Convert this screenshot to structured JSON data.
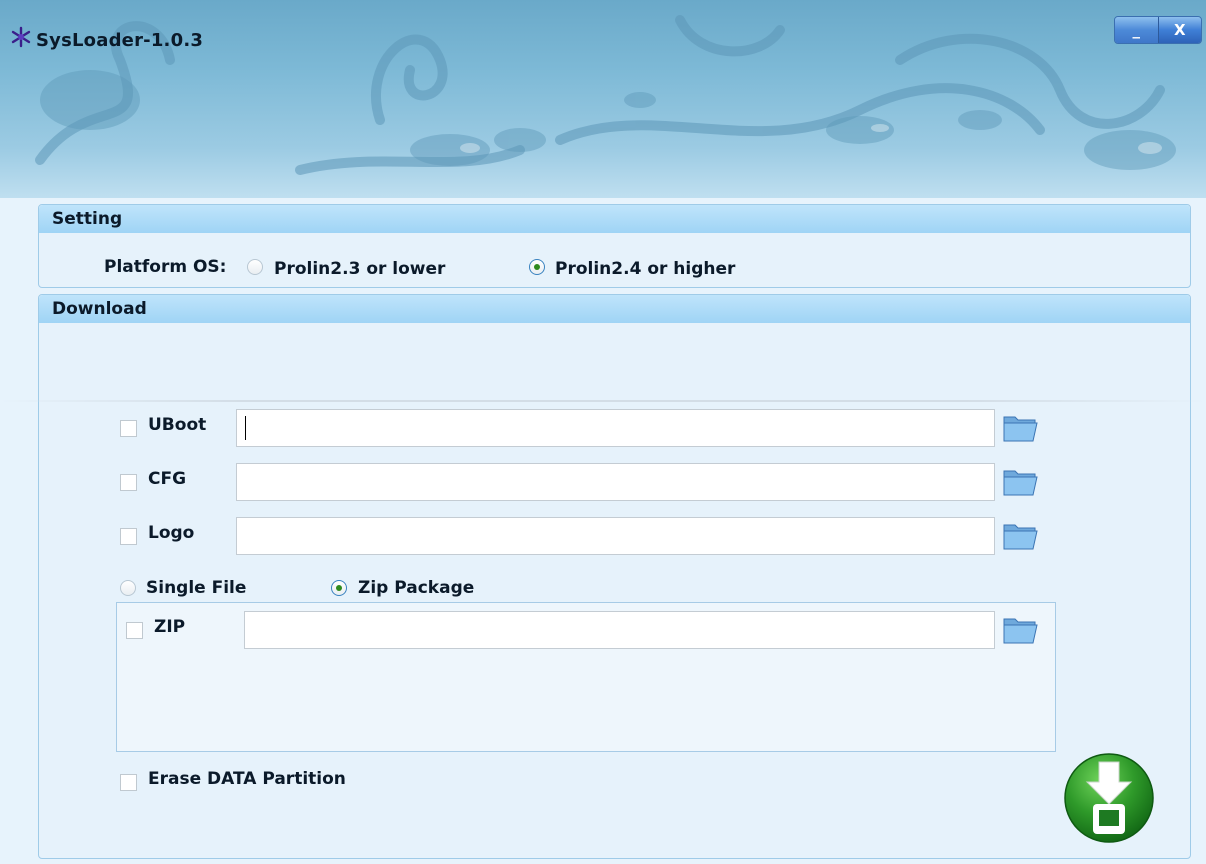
{
  "window": {
    "title": "SysLoader-1.0.3",
    "minimize_label": "_",
    "close_label": "X"
  },
  "setting": {
    "header": "Setting",
    "platform_label": "Platform OS:",
    "options": [
      {
        "label": "Prolin2.3 or lower",
        "selected": false
      },
      {
        "label": "Prolin2.4 or higher",
        "selected": true
      }
    ]
  },
  "download": {
    "header": "Download",
    "rows": [
      {
        "label": "UBoot",
        "checked": false,
        "value": ""
      },
      {
        "label": "CFG",
        "checked": false,
        "value": ""
      },
      {
        "label": "Logo",
        "checked": false,
        "value": ""
      }
    ],
    "mode_options": [
      {
        "label": "Single File",
        "selected": false
      },
      {
        "label": "Zip Package",
        "selected": true
      }
    ],
    "zip": {
      "label": "ZIP",
      "checked": false,
      "value": ""
    },
    "erase": {
      "label": "Erase DATA Partition",
      "checked": false
    }
  },
  "icons": {
    "app_logo": "app-logo-icon",
    "browse": "folder-open-icon",
    "download_action": "download-to-device-icon"
  },
  "colors": {
    "accent": "#2e8a1e",
    "panel_head": "#9fd4f5",
    "title_bar": "#7db9d6"
  }
}
